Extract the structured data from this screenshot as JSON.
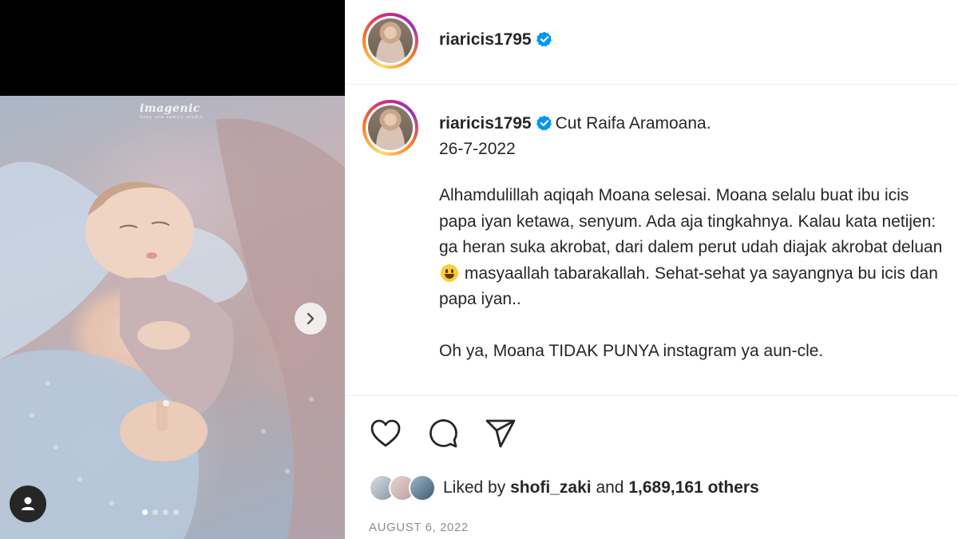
{
  "post": {
    "username": "riaricis1795",
    "verified": true,
    "media": {
      "watermark_title": "imagenic",
      "watermark_sub": "baby and family studio",
      "carousel_total": 4,
      "carousel_index": 1
    },
    "caption": {
      "first_line": "Cut Raifa Aramoana.",
      "date_line": "26-7-2022",
      "paragraph1_a": "Alhamdulillah aqiqah Moana selesai. Moana selalu buat ibu icis papa iyan ketawa, senyum. Ada aja tingkahnya. Kalau kata netijen: ga heran suka akrobat, dari dalem perut udah diajak akrobat deluan",
      "paragraph1_b": " masyaallah tabarakallah. Sehat-sehat ya sayangnya bu icis dan papa iyan..",
      "paragraph2": "Oh ya, Moana TIDAK PUNYA instagram ya aun-cle."
    },
    "likes": {
      "prefix": "Liked by ",
      "first_user": "shofi_zaki",
      "middle": " and ",
      "count": "1,689,161 others"
    },
    "timestamp": "AUGUST 6, 2022"
  },
  "icons": {
    "like": "heart-icon",
    "comment": "comment-icon",
    "share": "paper-plane-icon",
    "next": "chevron-right-icon",
    "tags": "user-tag-icon",
    "verified": "verified-badge-icon"
  },
  "colors": {
    "verified": "#0095f6",
    "text": "#262626",
    "muted": "#8e8e8e",
    "divider": "#efefef"
  }
}
